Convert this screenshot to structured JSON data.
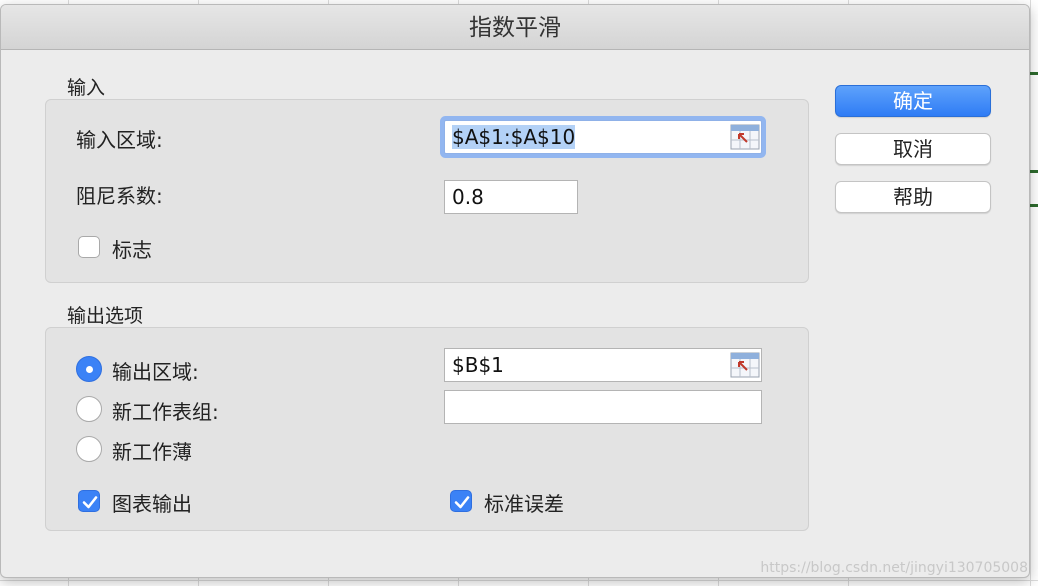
{
  "dialog": {
    "title": "指数平滑"
  },
  "input_section": {
    "label": "输入",
    "range_label": "输入区域:",
    "range_value": "$A$1:$A$10",
    "damping_label": "阻尼系数:",
    "damping_value": "0.8",
    "labels_checkbox": {
      "label": "标志",
      "checked": false
    }
  },
  "output_section": {
    "label": "输出选项",
    "options": [
      {
        "label": "输出区域:",
        "selected": true,
        "value": "$B$1"
      },
      {
        "label": "新工作表组:",
        "selected": false,
        "value": ""
      },
      {
        "label": "新工作薄",
        "selected": false
      }
    ],
    "chart_output": {
      "label": "图表输出",
      "checked": true
    },
    "std_errors": {
      "label": "标准误差",
      "checked": true
    }
  },
  "buttons": {
    "ok": "确定",
    "cancel": "取消",
    "help": "帮助"
  },
  "icons": {
    "range_picker": "range-collapse-icon",
    "checkmark": "checkmark-icon"
  },
  "colors": {
    "accent": "#3b82f6",
    "focus_ring": "#92b6f0",
    "selection": "#b3d1f6"
  },
  "watermark": "https://blog.csdn.net/jingyi130705008"
}
